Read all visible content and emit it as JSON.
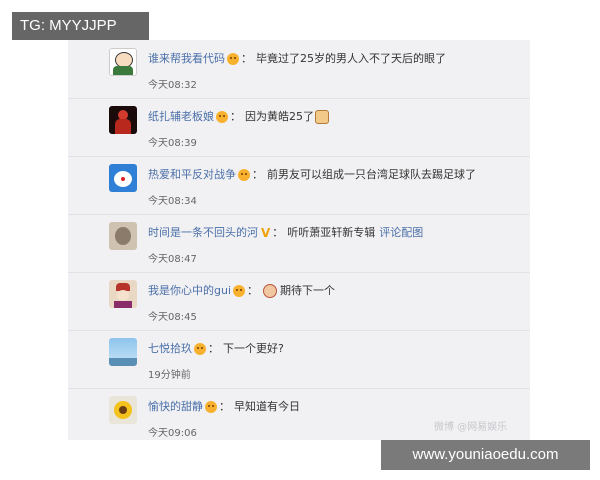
{
  "watermark_top": "TG: MYYJJPP",
  "watermark_bottom": "www.youniaoedu.com",
  "watermark_faint": "微博 @网易娱乐",
  "comments": [
    {
      "username": "谁来帮我看代码",
      "text": "毕竟过了25岁的男人入不了天后的眼了",
      "time": "今天08:32",
      "avatar_icon": "cartoon-boy-avatar",
      "badge_icon": "face-badge-icon"
    },
    {
      "username": "纸扎辅老板娘",
      "text": "因为黄皓25了",
      "text_emoji": "cat-emoji",
      "time": "今天08:39",
      "avatar_icon": "red-figure-avatar",
      "badge_icon": "face-badge-icon"
    },
    {
      "username": "热爱和平反对战争",
      "text": "前男友可以组成一只台湾足球队去踢足球了",
      "time": "今天08:34",
      "avatar_icon": "doraemon-avatar",
      "badge_icon": "face-badge-icon"
    },
    {
      "username": "时间是一条不回头的河",
      "text": "听听萧亚轩新专辑",
      "link": "评论配图",
      "time": "今天08:47",
      "avatar_icon": "beige-avatar",
      "badge_icon": "v-badge-icon"
    },
    {
      "username": "我是你心中的gui",
      "text": "期待下一个",
      "text_emoji_before": "face-emoji",
      "time": "今天08:45",
      "avatar_icon": "costume-avatar",
      "badge_icon": "face-badge-icon"
    },
    {
      "username": "七悦拾玖",
      "text": "下一个更好?",
      "time": "19分钟前",
      "avatar_icon": "sky-avatar",
      "badge_icon": "face-badge-icon"
    },
    {
      "username": "愉快的甜静",
      "text": "早知道有今日",
      "time": "今天09:06",
      "avatar_icon": "sunflower-avatar",
      "badge_icon": "face-badge-icon"
    }
  ],
  "colors": {
    "username": "#4a6fa8",
    "panel": "#f1f1f3",
    "badge": "#f7b12e"
  }
}
